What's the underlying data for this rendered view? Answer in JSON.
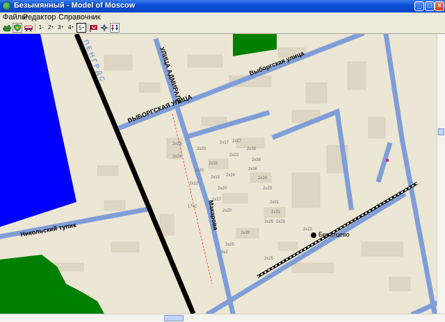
{
  "window": {
    "title": "Безымянный - Model of Moscow"
  },
  "menu": {
    "items": [
      "Файлы",
      "Редактор",
      "Справочник"
    ]
  },
  "toolbar": {
    "level_buttons": [
      "1",
      "2",
      "3",
      "4",
      "5"
    ],
    "level_suffix": "+",
    "level_prefix_1": "-"
  },
  "map": {
    "streets": {
      "vyborgskaya": "ВЫБОРГСКАЯ УЛИЦА",
      "vyborgskaya_short": "Выборгская улица",
      "admirala": "УЛИЦА АДМИРАЛА",
      "makarova": "Макарова",
      "nikolsky": "Никольский тупик",
      "pgn": "П Е Н Г Р Д С"
    },
    "station": "Бератцево",
    "building_labels": [
      "2x20",
      "2x17",
      "2x17",
      "2x38",
      "2x38",
      "2x23",
      "2x36",
      "2x24",
      "2x18",
      "2x24",
      "2x15",
      "2x33",
      "2x31",
      "2x20",
      "2x31",
      "2x29",
      "2x17",
      "2x20",
      "2x29",
      "2x29",
      "2x25",
      "9x2",
      "2x25",
      "2x23",
      "2x24",
      "2x12",
      "17x2",
      "2x25",
      "2x22"
    ],
    "colors": {
      "street": "#7f9ed8",
      "land": "#ece6d4",
      "water": "#0000ff",
      "park": "#008000",
      "rail": "#000000",
      "building": "#dcd6c2"
    }
  }
}
